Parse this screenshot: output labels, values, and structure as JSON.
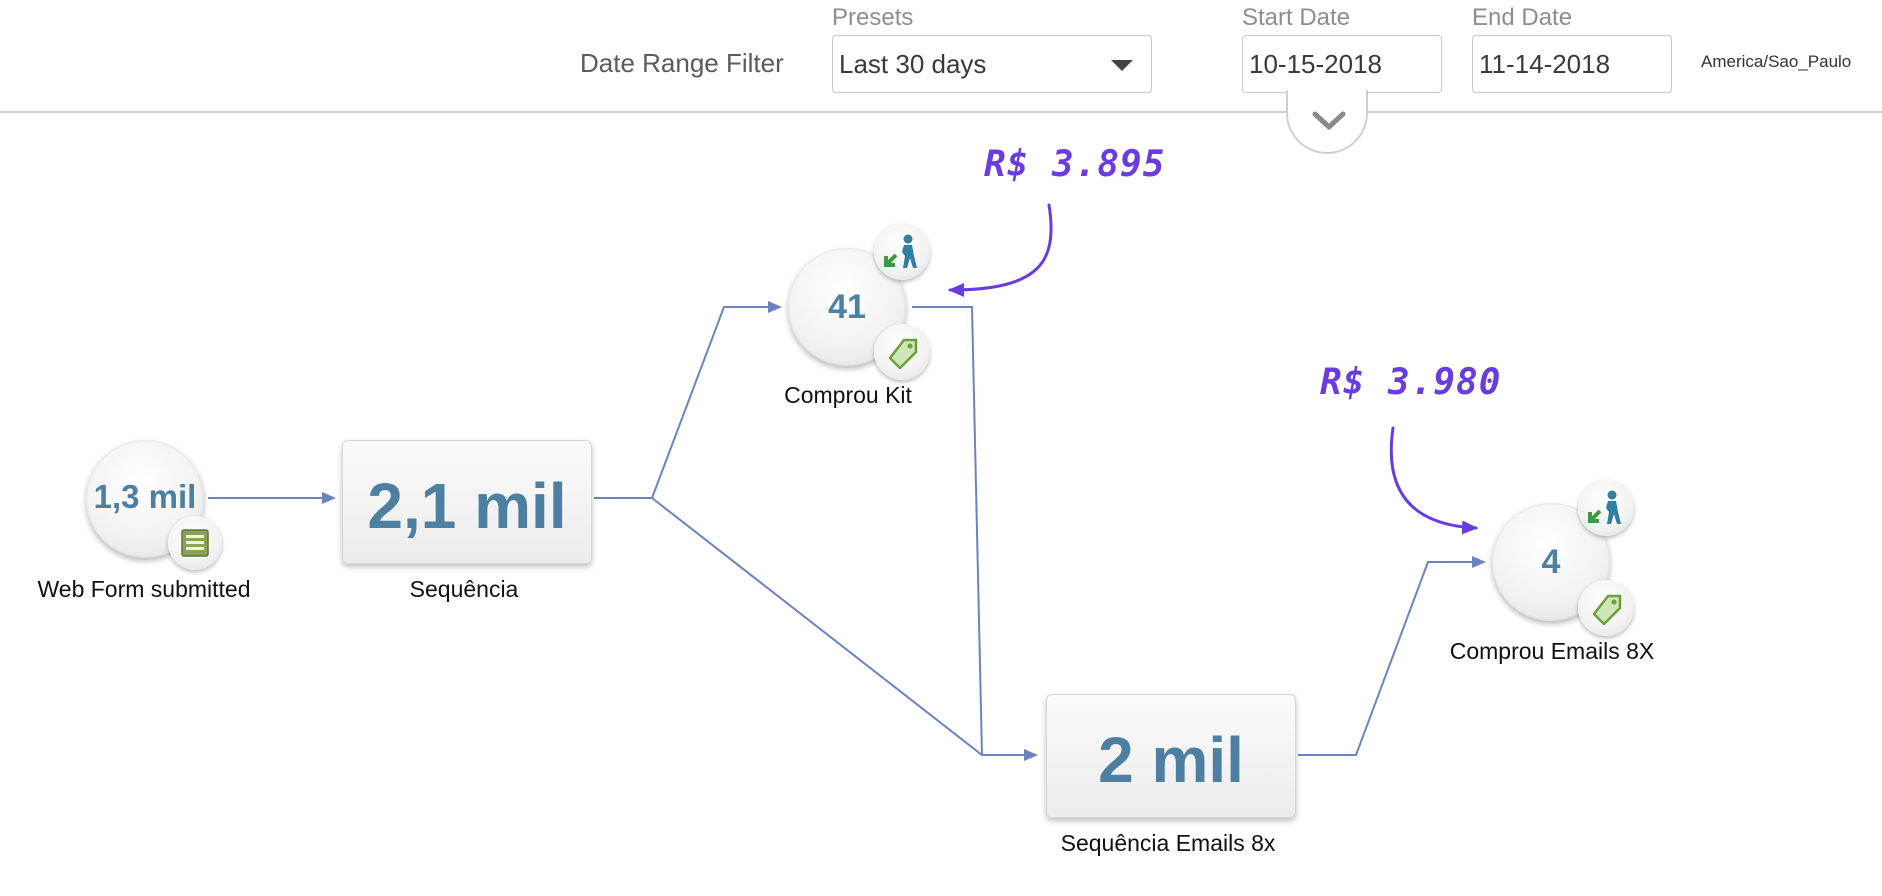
{
  "filter": {
    "label": "Date Range Filter",
    "presets_caption": "Presets",
    "presets_value": "Last 30 days",
    "start_caption": "Start Date",
    "start_value": "10-15-2018",
    "end_caption": "End Date",
    "end_value": "11-14-2018",
    "timezone": "America/Sao_Paulo"
  },
  "nodes": {
    "web_form": {
      "value": "1,3 mil",
      "label": "Web Form submitted",
      "icon": "form-icon"
    },
    "sequencia": {
      "value": "2,1 mil",
      "label": "Sequência"
    },
    "comprou_kit": {
      "value": "41",
      "label": "Comprou Kit",
      "icons": [
        "goal-person-icon",
        "tag-icon"
      ]
    },
    "sequencia_emails": {
      "value": "2 mil",
      "label": "Sequência Emails 8x"
    },
    "comprou_emails": {
      "value": "4",
      "label": "Comprou Emails 8X",
      "icons": [
        "goal-person-icon",
        "tag-icon"
      ]
    }
  },
  "annotations": {
    "kit_revenue": "R$ 3.895",
    "emails_revenue": "R$ 3.980"
  },
  "colors": {
    "connector": "#6b83c0",
    "node_value": "#4d7fa0",
    "annotation": "#6a3ce0"
  }
}
